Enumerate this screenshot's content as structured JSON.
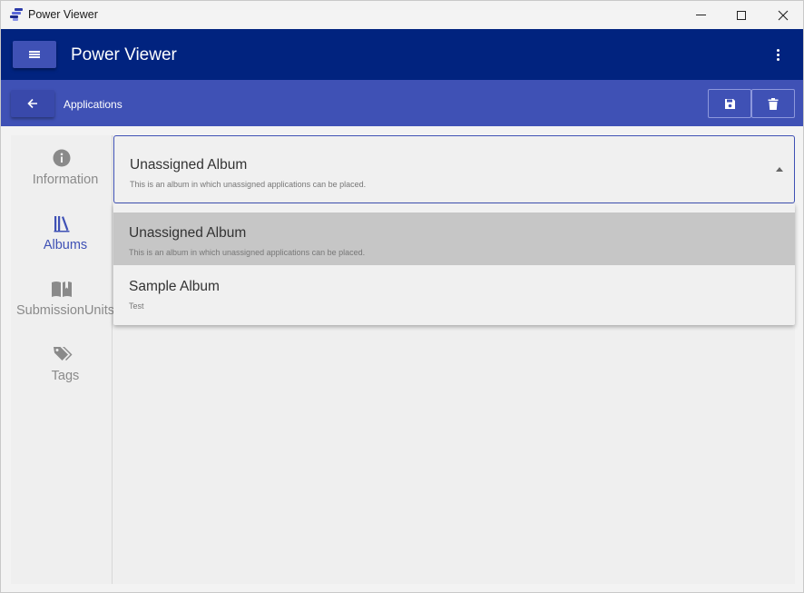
{
  "window": {
    "title": "Power Viewer"
  },
  "header": {
    "title": "Power Viewer"
  },
  "toolbar": {
    "title": "Applications"
  },
  "sidebar": {
    "items": [
      {
        "label": "Information",
        "icon": "info-circle-icon",
        "active": false
      },
      {
        "label": "Albums",
        "icon": "library-icon",
        "active": true
      },
      {
        "label": "SubmissionUnits",
        "icon": "open-book-icon",
        "active": false
      },
      {
        "label": "Tags",
        "icon": "tags-icon",
        "active": false
      }
    ]
  },
  "album_select": {
    "selected": {
      "name": "Unassigned Album",
      "description": "This is an album in which unassigned applications can be placed."
    },
    "options": [
      {
        "name": "Unassigned Album",
        "description": "This is an album in which unassigned applications can be placed.",
        "selected": true
      },
      {
        "name": "Sample Album",
        "description": "Test",
        "selected": false
      }
    ]
  },
  "colors": {
    "header": "#01237f",
    "toolbar": "#3f51b5",
    "accent": "#3f51b5",
    "selected_option": "#c6c6c6"
  }
}
